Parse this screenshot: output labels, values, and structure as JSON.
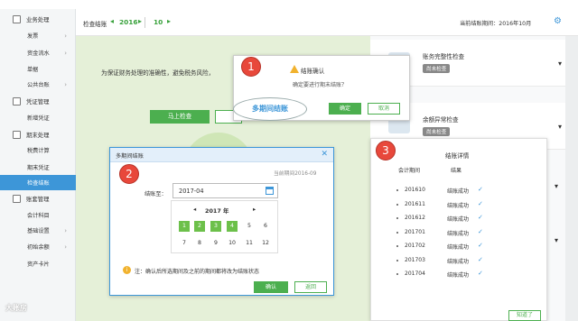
{
  "sidebar": {
    "items": [
      {
        "label": "业务处理",
        "kind": "group"
      },
      {
        "label": "发票",
        "kind": "sub",
        "arrow": "›"
      },
      {
        "label": "资金流水",
        "kind": "sub",
        "arrow": "›"
      },
      {
        "label": "单据",
        "kind": "sub",
        "arrow": ""
      },
      {
        "label": "公共台账",
        "kind": "sub",
        "arrow": "›"
      },
      {
        "label": "凭证管理",
        "kind": "group"
      },
      {
        "label": "新增凭证",
        "kind": "sub",
        "arrow": ""
      },
      {
        "label": "期末处理",
        "kind": "group"
      },
      {
        "label": "税费计算",
        "kind": "sub",
        "arrow": ""
      },
      {
        "label": "期末凭证",
        "kind": "sub",
        "arrow": ""
      },
      {
        "label": "检查结账",
        "kind": "sub",
        "arrow": "",
        "active": true
      },
      {
        "label": "账套管理",
        "kind": "group"
      },
      {
        "label": "会计科目",
        "kind": "sub",
        "arrow": ""
      },
      {
        "label": "基础设置",
        "kind": "sub",
        "arrow": "›"
      },
      {
        "label": "初始余额",
        "kind": "sub",
        "arrow": "›"
      },
      {
        "label": "资产卡片",
        "kind": "sub",
        "arrow": ""
      }
    ]
  },
  "topbar": {
    "title": "检查结账",
    "prev_arrow": "◂",
    "year": "2016",
    "next_arrow": "▸",
    "month_prev_arrow": "◂",
    "month": "10",
    "month_next_arrow": "▸",
    "current_period": "当前结账期间：2016年10月",
    "settings_icon": "⚙"
  },
  "main": {
    "intro": "为保证财务处理的准确性，避免税务风险，",
    "check_button": "马上检查"
  },
  "right_panel": {
    "cards": [
      {
        "title": "账务完整性检查",
        "badge": "尚未检查"
      },
      {
        "title": "余额异常检查",
        "badge": "尚未检查"
      }
    ],
    "caret": "▾"
  },
  "dialog1": {
    "number": "1",
    "title": "结账确认",
    "question": "确定要进行期末结账？",
    "confirm": "确定",
    "cancel": "取消",
    "multi_period": "多期间结账"
  },
  "dialog2": {
    "number": "2",
    "title": "多期间结账",
    "close": "✕",
    "current_period": "当前期间2016-09",
    "field_label": "结账至：",
    "field_value": "2017-04",
    "year_label": "2017 年",
    "nav_prev": "◂",
    "nav_next": "▸",
    "months": [
      "1",
      "2",
      "3",
      "4",
      "5",
      "6",
      "7",
      "8",
      "9",
      "10",
      "11",
      "12"
    ],
    "selected_months": [
      "1",
      "2",
      "3",
      "4"
    ],
    "note_icon": "i",
    "note": "注：确认后所选期间及之前的期间都将改为结账状态",
    "confirm": "确认",
    "back": "返回"
  },
  "dialog3": {
    "number": "3",
    "title": "结账详情",
    "col_period": "会计期间",
    "col_result": "结果",
    "rows": [
      {
        "period": "201610",
        "result": "结账成功",
        "check": "✓"
      },
      {
        "period": "201611",
        "result": "结账成功",
        "check": "✓"
      },
      {
        "period": "201612",
        "result": "结账成功",
        "check": "✓"
      },
      {
        "period": "201701",
        "result": "结账成功",
        "check": "✓"
      },
      {
        "period": "201702",
        "result": "结账成功",
        "check": "✓"
      },
      {
        "period": "201703",
        "result": "结账成功",
        "check": "✓"
      },
      {
        "period": "201704",
        "result": "结账成功",
        "check": "✓"
      }
    ],
    "got_it": "知道了"
  },
  "watermark": "大账房"
}
